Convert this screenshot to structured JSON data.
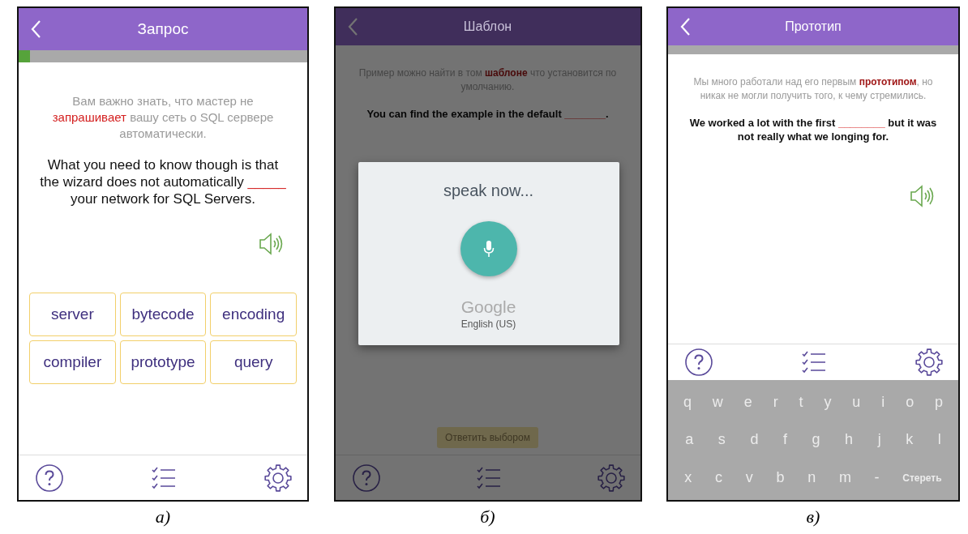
{
  "panels": [
    {
      "kind": "choices",
      "title": "Запрос",
      "progress": {
        "level": 0.04
      },
      "hint": [
        {
          "text": "Вам важно знать, что мастер не "
        },
        {
          "text": "запрашивает",
          "highlight": true
        },
        {
          "text": " вашу сеть о SQL сервере автоматически."
        }
      ],
      "sentence": [
        {
          "text": "What you need to know though is that the wizard does not automatically "
        },
        {
          "blank": "_____"
        },
        {
          "text": " your network for SQL Servers."
        }
      ],
      "choices": [
        "server",
        "bytecode",
        "encoding",
        "compiler",
        "prototype",
        "query"
      ],
      "caption": "а)"
    },
    {
      "kind": "voice",
      "title": "Шаблон",
      "dimmed": true,
      "hint": [
        {
          "text": "Пример можно найти в том "
        },
        {
          "text": "**шаблоне**",
          "highlight": true
        },
        {
          "text": " что установится по умолчанию."
        }
      ],
      "sentence": [
        {
          "text": "You can find the example in the default "
        },
        {
          "blank": "_______"
        },
        {
          "text": "."
        }
      ],
      "dialog": {
        "prompt": "speak now...",
        "brand": "Google",
        "language": "English (US)"
      },
      "answer_button": "Ответить выбором",
      "caption": "б)"
    },
    {
      "kind": "keyboard",
      "title": "Прототип",
      "progress": {
        "level": 0
      },
      "hint": [
        {
          "text": "Мы много работали над его первым "
        },
        {
          "text": "**прототипом**",
          "highlight": true
        },
        {
          "text": ", но никак не могли получить того, к чему стремились."
        }
      ],
      "sentence": [
        {
          "text": "We worked a lot with the first "
        },
        {
          "blank": "________"
        },
        {
          "text": " but it was not really what we longing for."
        }
      ],
      "keyboard": [
        [
          {
            "kind": "letter",
            "label": "q"
          },
          {
            "kind": "letter",
            "label": "w"
          },
          {
            "kind": "letter",
            "label": "e"
          },
          {
            "kind": "letter",
            "label": "r"
          },
          {
            "kind": "letter",
            "label": "t"
          },
          {
            "kind": "letter",
            "label": "y"
          },
          {
            "kind": "letter",
            "label": "u"
          },
          {
            "kind": "letter",
            "label": "i"
          },
          {
            "kind": "letter",
            "label": "o"
          },
          {
            "kind": "letter",
            "label": "p"
          }
        ],
        [
          {
            "kind": "letter",
            "label": "a"
          },
          {
            "kind": "letter",
            "label": "s"
          },
          {
            "kind": "letter",
            "label": "d"
          },
          {
            "kind": "letter",
            "label": "f"
          },
          {
            "kind": "letter",
            "label": "g"
          },
          {
            "kind": "letter",
            "label": "h"
          },
          {
            "kind": "letter",
            "label": "j"
          },
          {
            "kind": "letter",
            "label": "k"
          },
          {
            "kind": "letter",
            "label": "l"
          }
        ],
        [
          {
            "kind": "letter",
            "label": "x"
          },
          {
            "kind": "letter",
            "label": "c"
          },
          {
            "kind": "letter",
            "label": "v"
          },
          {
            "kind": "letter",
            "label": "b"
          },
          {
            "kind": "letter",
            "label": "n"
          },
          {
            "kind": "letter",
            "label": "m"
          },
          {
            "kind": "letter",
            "label": "-"
          },
          {
            "kind": "action",
            "label": "Стереть"
          }
        ]
      ],
      "caption": "в)"
    }
  ]
}
